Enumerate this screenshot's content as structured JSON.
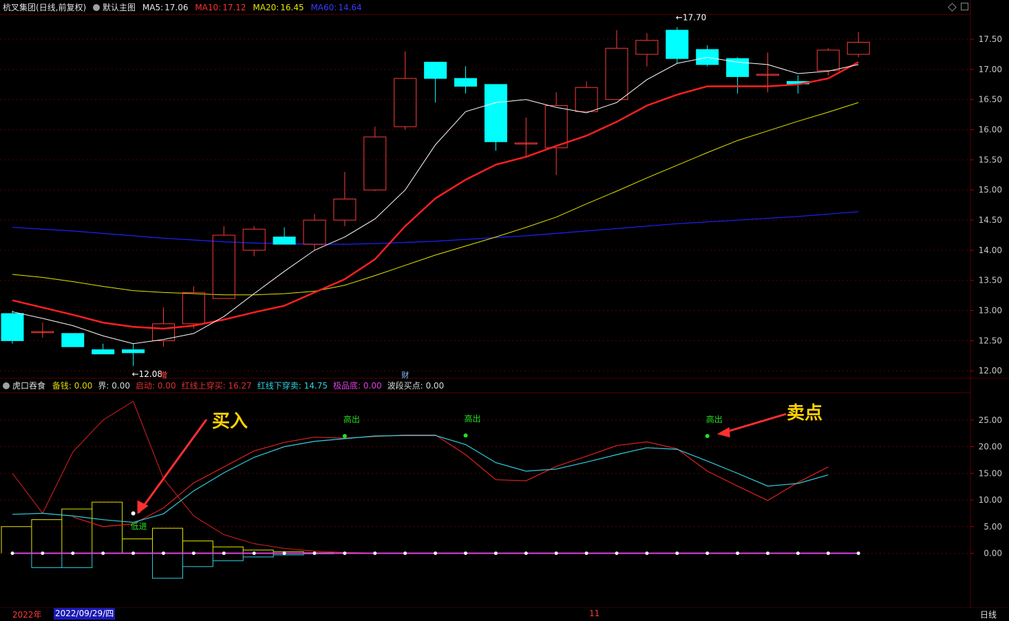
{
  "header": {
    "stock": "杭叉集团",
    "mode": "(日线,前复权)",
    "template": "默认主图",
    "ma5_label": "MA5:",
    "ma5": "17.06",
    "ma10_label": "MA10:",
    "ma10": "17.12",
    "ma20_label": "MA20:",
    "ma20": "16.45",
    "ma60_label": "MA60:",
    "ma60": "14.64"
  },
  "indicator": {
    "name": "虎口吞食",
    "items": [
      {
        "label": "备钱:",
        "value": "0.00",
        "color": "#e0d800"
      },
      {
        "label": "界:",
        "value": "0.00",
        "color": "#d8d8d8"
      },
      {
        "label": "启动:",
        "value": "0.00",
        "color": "#e03030"
      },
      {
        "label": "红线上穿买:",
        "value": "16.27",
        "color": "#e03030"
      },
      {
        "label": "红线下穿卖:",
        "value": "14.75",
        "color": "#30d0e0"
      },
      {
        "label": "极品底:",
        "value": "0.00",
        "color": "#e040e0"
      },
      {
        "label": "波段买点:",
        "value": "0.00",
        "color": "#d8d8d8"
      }
    ]
  },
  "colors": {
    "up": "#ff3b3b",
    "down": "#00ffff",
    "ma5": "#ffffff",
    "ma10": "#ff2020",
    "ma20": "#e6e600",
    "ma60": "#2020ff",
    "bg": "#000000",
    "grid": "#5a0000"
  },
  "chart_data": [
    {
      "type": "candlestick",
      "yticks": [
        "17.50",
        "17.00",
        "16.50",
        "16.00",
        "15.50",
        "15.00",
        "14.50",
        "14.00",
        "13.50",
        "13.00",
        "12.50",
        "12.00"
      ],
      "ylim": [
        11.9,
        17.9
      ],
      "candles": [
        {
          "o": 12.95,
          "h": 13.0,
          "l": 12.45,
          "c": 12.5
        },
        {
          "o": 12.65,
          "h": 12.8,
          "l": 12.55,
          "c": 12.65
        },
        {
          "o": 12.62,
          "h": 12.62,
          "l": 12.4,
          "c": 12.4
        },
        {
          "o": 12.35,
          "h": 12.45,
          "l": 12.28,
          "c": 12.28
        },
        {
          "o": 12.35,
          "h": 12.45,
          "l": 12.08,
          "c": 12.3
        },
        {
          "o": 12.5,
          "h": 13.05,
          "l": 12.4,
          "c": 12.78
        },
        {
          "o": 12.78,
          "h": 13.4,
          "l": 12.7,
          "c": 13.3
        },
        {
          "o": 13.2,
          "h": 14.4,
          "l": 13.2,
          "c": 14.25
        },
        {
          "o": 14.0,
          "h": 14.4,
          "l": 13.9,
          "c": 14.35
        },
        {
          "o": 14.22,
          "h": 14.38,
          "l": 14.1,
          "c": 14.1
        },
        {
          "o": 14.1,
          "h": 14.6,
          "l": 14.0,
          "c": 14.5
        },
        {
          "o": 14.5,
          "h": 15.3,
          "l": 14.4,
          "c": 14.85
        },
        {
          "o": 15.0,
          "h": 16.05,
          "l": 14.98,
          "c": 15.88
        },
        {
          "o": 16.05,
          "h": 17.3,
          "l": 16.0,
          "c": 16.85
        },
        {
          "o": 17.12,
          "h": 17.12,
          "l": 16.45,
          "c": 16.85
        },
        {
          "o": 16.85,
          "h": 17.05,
          "l": 16.6,
          "c": 16.72
        },
        {
          "o": 16.75,
          "h": 16.75,
          "l": 15.65,
          "c": 15.8
        },
        {
          "o": 15.78,
          "h": 16.2,
          "l": 15.55,
          "c": 15.78
        },
        {
          "o": 15.7,
          "h": 16.62,
          "l": 15.25,
          "c": 16.4
        },
        {
          "o": 16.3,
          "h": 16.8,
          "l": 16.3,
          "c": 16.7
        },
        {
          "o": 16.5,
          "h": 17.65,
          "l": 16.5,
          "c": 17.35
        },
        {
          "o": 17.25,
          "h": 17.6,
          "l": 17.05,
          "c": 17.48
        },
        {
          "o": 17.65,
          "h": 17.7,
          "l": 17.1,
          "c": 17.18
        },
        {
          "o": 17.33,
          "h": 17.4,
          "l": 17.05,
          "c": 17.08
        },
        {
          "o": 17.18,
          "h": 17.2,
          "l": 16.6,
          "c": 16.88
        },
        {
          "o": 16.92,
          "h": 17.28,
          "l": 16.62,
          "c": 16.92
        },
        {
          "o": 16.8,
          "h": 16.9,
          "l": 16.6,
          "c": 16.76
        },
        {
          "o": 16.98,
          "h": 17.35,
          "l": 16.9,
          "c": 17.32
        },
        {
          "o": 17.25,
          "h": 17.62,
          "l": 17.2,
          "c": 17.45
        }
      ],
      "ma5": [
        12.98,
        12.87,
        12.75,
        12.58,
        12.45,
        12.52,
        12.62,
        12.9,
        13.28,
        13.65,
        14.0,
        14.22,
        14.52,
        15.0,
        15.75,
        16.3,
        16.45,
        16.5,
        16.37,
        16.28,
        16.45,
        16.83,
        17.1,
        17.2,
        17.12,
        17.08,
        16.93,
        16.97,
        17.08
      ],
      "ma10": [
        13.17,
        13.05,
        12.93,
        12.8,
        12.73,
        12.7,
        12.75,
        12.85,
        12.97,
        13.08,
        13.3,
        13.52,
        13.85,
        14.4,
        14.86,
        15.17,
        15.42,
        15.55,
        15.73,
        15.9,
        16.13,
        16.4,
        16.58,
        16.72,
        16.72,
        16.72,
        16.75,
        16.85,
        17.12
      ],
      "ma20": [
        13.6,
        13.55,
        13.48,
        13.4,
        13.33,
        13.3,
        13.28,
        13.26,
        13.26,
        13.28,
        13.32,
        13.42,
        13.58,
        13.75,
        13.92,
        14.07,
        14.22,
        14.38,
        14.55,
        14.77,
        14.98,
        15.2,
        15.41,
        15.62,
        15.82,
        15.98,
        16.14,
        16.29,
        16.45
      ],
      "ma60": [
        14.38,
        14.35,
        14.32,
        14.28,
        14.24,
        14.2,
        14.17,
        14.14,
        14.12,
        14.11,
        14.1,
        14.1,
        14.11,
        14.13,
        14.15,
        14.18,
        14.21,
        14.24,
        14.28,
        14.32,
        14.36,
        14.4,
        14.44,
        14.47,
        14.5,
        14.53,
        14.56,
        14.6,
        14.64
      ],
      "labels": [
        {
          "i": 4,
          "price": 12.08,
          "text": "←12.08"
        },
        {
          "i": 22,
          "price": 17.7,
          "text": "←17.70"
        }
      ],
      "markers": [
        {
          "i": 5,
          "text": "增",
          "color": "#ff5050"
        },
        {
          "i": 13,
          "text": "财",
          "color": "#80c0ff"
        }
      ]
    },
    {
      "type": "line",
      "yticks": [
        "25.00",
        "20.00",
        "15.00",
        "10.00",
        "5.00",
        "0.00"
      ],
      "ylim": [
        -10,
        30
      ],
      "red": [
        15,
        7.5,
        19,
        25,
        28.5,
        14,
        7,
        3.5,
        1.8,
        0.9,
        0.4,
        0.15,
        0.05,
        0.02,
        0.01,
        0.0,
        0.0,
        0.0,
        0.0,
        0.0,
        0.0,
        0.0,
        0.0,
        0.0,
        0.0,
        0.0,
        0.0,
        0.0,
        0.0
      ],
      "red_main": [
        null,
        null,
        6.8,
        5.0,
        5.5,
        8.5,
        13.2,
        16.2,
        19.2,
        20.8,
        21.8,
        21.6,
        21.9,
        22.2,
        22.2,
        18.5,
        13.8,
        13.6,
        16.3,
        18.2,
        20.2,
        20.9,
        19.6,
        15.4,
        12.6,
        9.9,
        13.3,
        16.2,
        null
      ],
      "cyan_main": [
        7.3,
        7.5,
        7.0,
        6.3,
        5.8,
        7.4,
        11.7,
        15.1,
        18.0,
        20.0,
        21.0,
        21.5,
        22.0,
        22.1,
        22.1,
        20.4,
        17.0,
        15.4,
        15.8,
        17.1,
        18.5,
        19.8,
        19.5,
        17.3,
        15.0,
        12.6,
        13.1,
        14.7,
        null
      ],
      "yellow_steps": [
        5.0,
        6.3,
        8.3,
        9.6,
        2.7,
        4.7,
        2.3,
        1.2,
        0.6,
        0.3,
        0.1,
        0.05,
        0.0,
        0.0,
        0.0,
        0.0,
        0.0,
        0.0,
        0.0,
        0.0,
        0.0,
        0.0,
        0.0,
        0.0,
        0.0,
        0.0,
        0.0,
        0.0,
        0.0
      ],
      "cyan_steps": [
        null,
        -2.7,
        -2.7,
        null,
        null,
        -4.7,
        -2.5,
        -1.4,
        -0.7,
        -0.3,
        -0.1,
        -0.05,
        0.0,
        0.0,
        0.0,
        0.0,
        0.0,
        0.0,
        0.0,
        0.0,
        0.0,
        0.0,
        0.0,
        0.0,
        0.0,
        0.0,
        0.0,
        0.0,
        0.0
      ],
      "signals": [
        {
          "i": 4,
          "value": 7.1,
          "text": "低进",
          "below": true,
          "dot": "#ffffff"
        },
        {
          "i": 11,
          "value": 22.0,
          "text": "高出",
          "below": false,
          "dot": "#20e020"
        },
        {
          "i": 15,
          "value": 22.1,
          "text": "高出",
          "below": false,
          "dot": "#20e020"
        },
        {
          "i": 23,
          "value": 22.0,
          "text": "高出",
          "below": false,
          "dot": "#20e020"
        }
      ],
      "annotations": [
        {
          "text": "买入",
          "color": "#ffd400"
        },
        {
          "text": "卖点",
          "color": "#ffd400"
        }
      ]
    }
  ],
  "footer": {
    "year": "2022年",
    "date": "2022/09/29/四",
    "month_mark": "11",
    "period": "日线"
  }
}
